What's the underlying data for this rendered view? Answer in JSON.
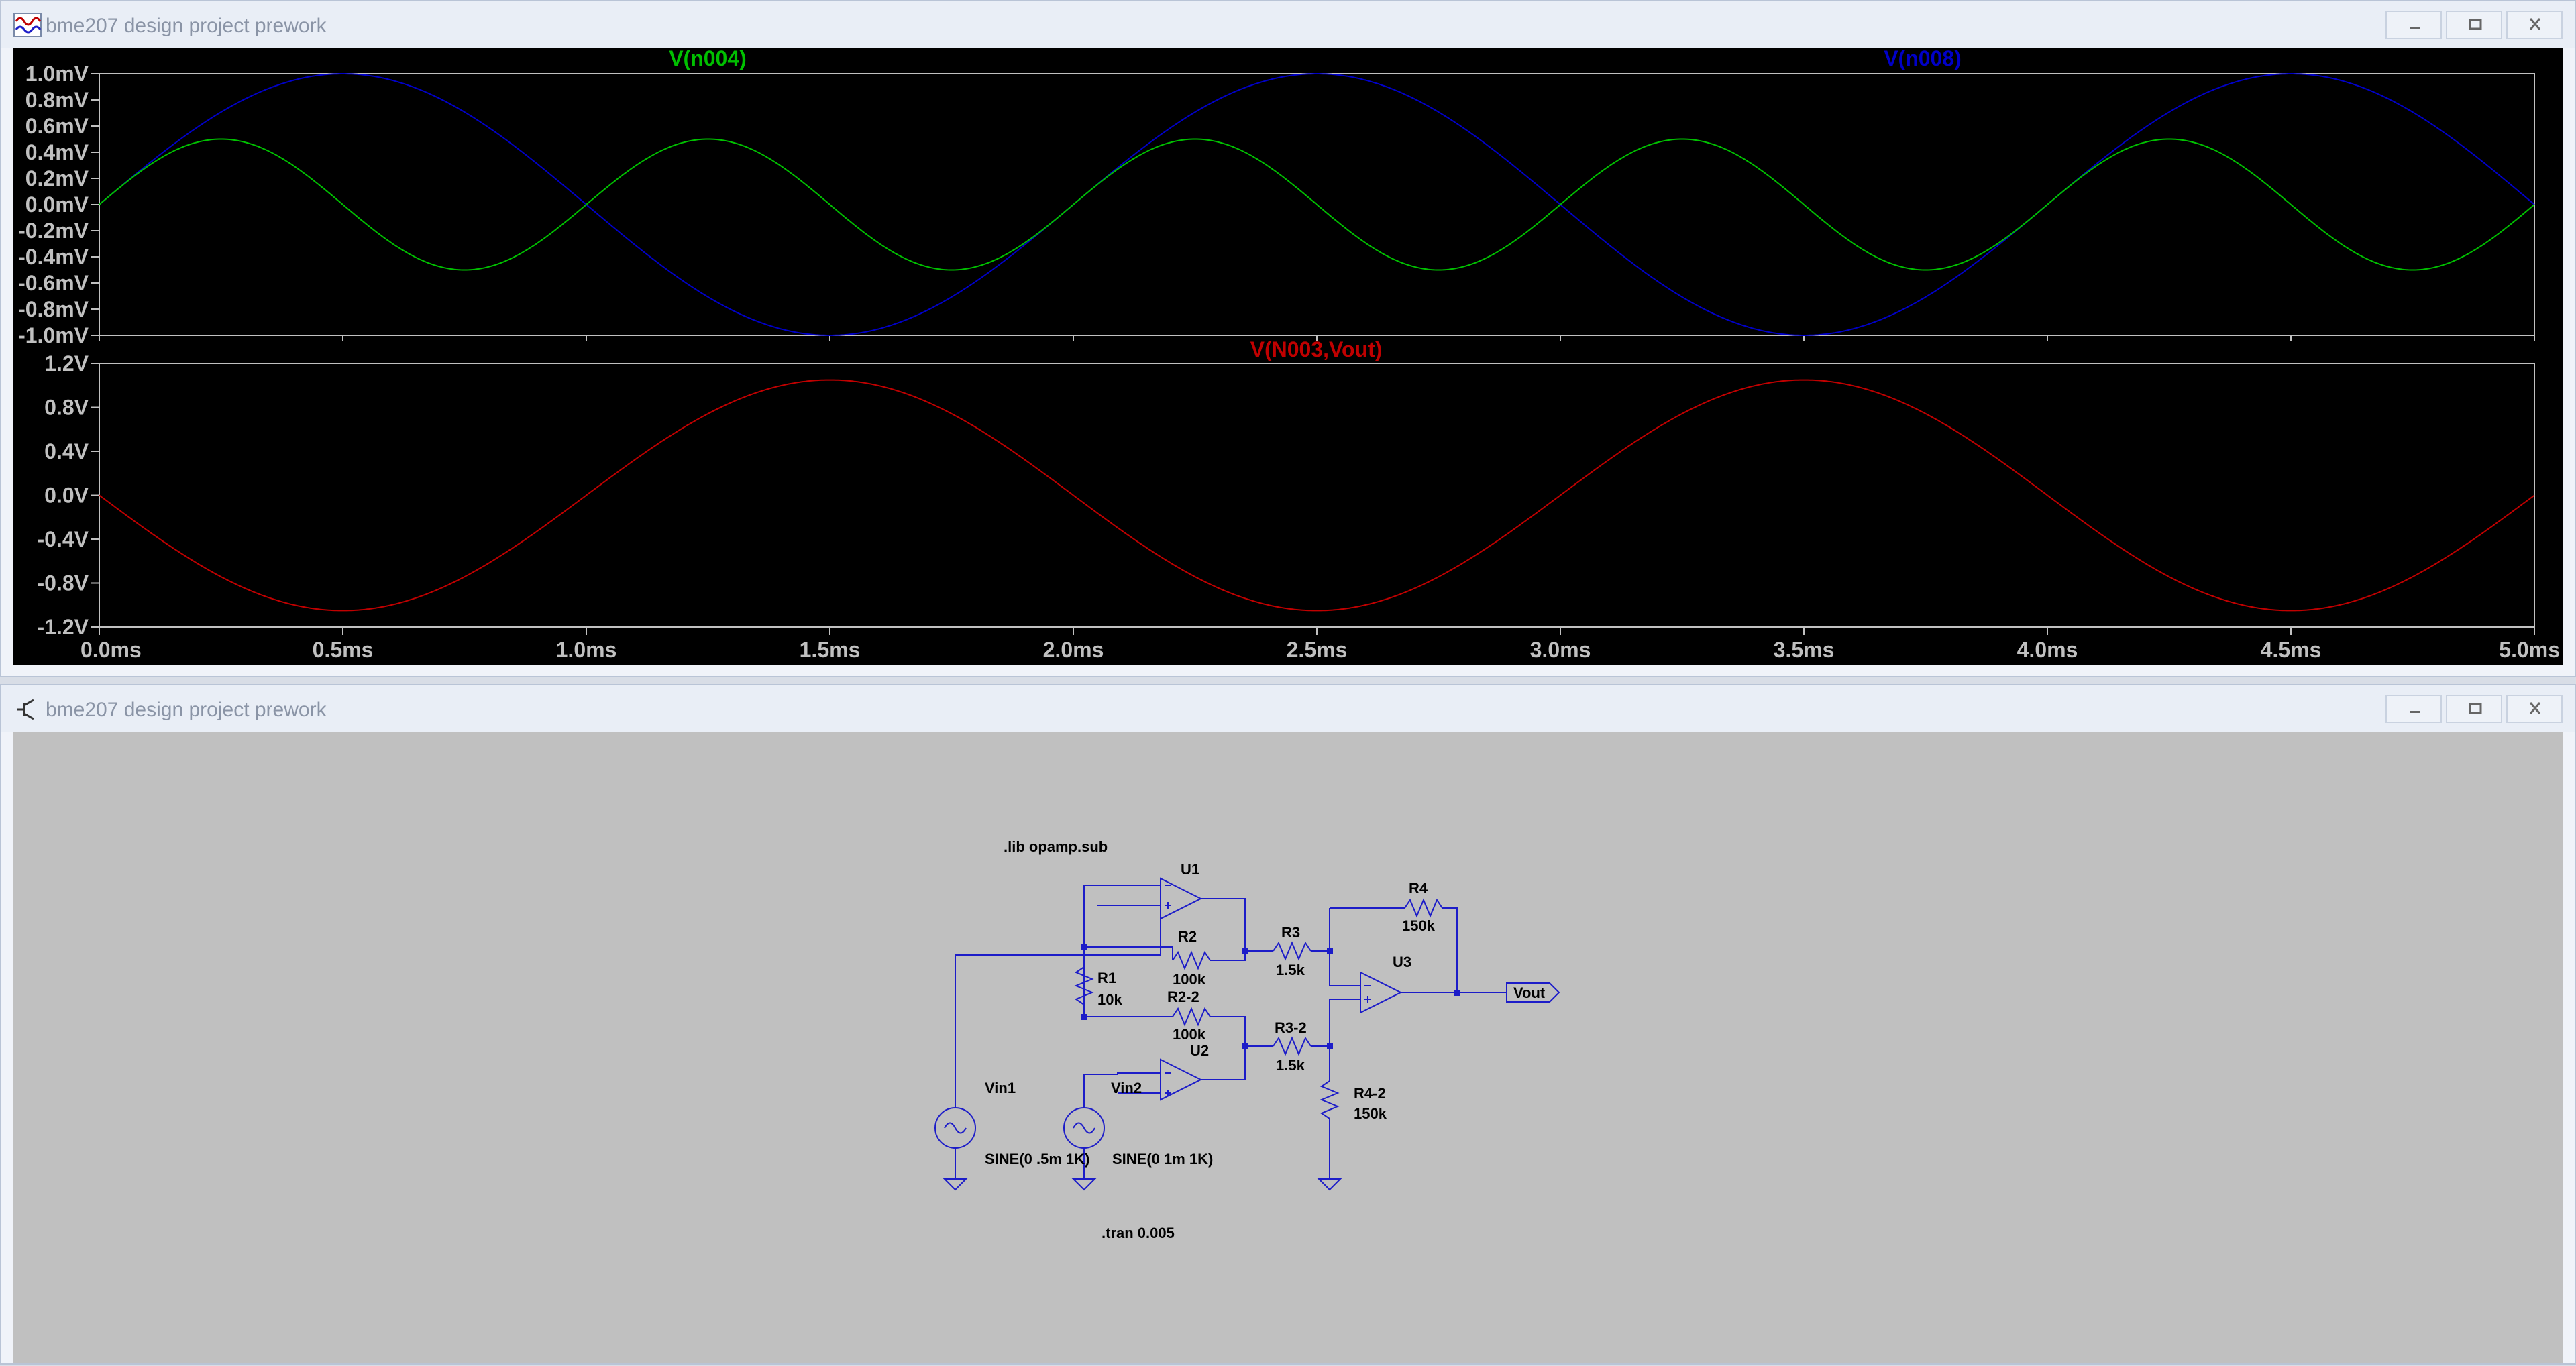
{
  "waveform_window": {
    "title": "bme207 design project prework",
    "icon": "waveform-viewer-icon"
  },
  "schematic_window": {
    "title": "bme207 design project prework",
    "icon": "schematic-editor-icon"
  },
  "window_buttons": {
    "minimize": "minimize-icon",
    "restore": "restore-icon",
    "close": "close-icon"
  },
  "colors": {
    "n004": "#00c000",
    "n008": "#0000c8",
    "diff": "#c00000",
    "wire": "#1c1cc8",
    "plot_bg": "#000000",
    "schematic_bg": "#c0c0c0"
  },
  "chart_data": [
    {
      "type": "line",
      "title": "",
      "xlabel": "",
      "ylabel": "",
      "series": [
        {
          "name": "V(n004)",
          "color": "#00c000",
          "function": "sine",
          "amplitude_mV": 0.5,
          "frequency_Hz": 1000
        },
        {
          "name": "V(n008)",
          "color": "#0000c8",
          "function": "sine",
          "amplitude_mV": 1.0,
          "frequency_Hz": 500
        }
      ],
      "xlim": [
        0,
        5
      ],
      "ylim": [
        -1.0,
        1.0
      ],
      "yticks": [
        "1.0mV",
        "0.8mV",
        "0.6mV",
        "0.4mV",
        "0.2mV",
        "0.0mV",
        "-0.2mV",
        "-0.4mV",
        "-0.6mV",
        "-0.8mV",
        "-1.0mV"
      ],
      "ytick_values": [
        1.0,
        0.8,
        0.6,
        0.4,
        0.2,
        0.0,
        -0.2,
        -0.4,
        -0.6,
        -0.8,
        -1.0
      ]
    },
    {
      "type": "line",
      "title": "",
      "xlabel": "",
      "ylabel": "",
      "series": [
        {
          "name": "V(N003,Vout)",
          "color": "#c00000",
          "function": "neg_sine",
          "amplitude_V": 1.05,
          "frequency_Hz": 500
        }
      ],
      "xlim": [
        0,
        5
      ],
      "ylim": [
        -1.2,
        1.2
      ],
      "yticks": [
        "1.2V",
        "0.8V",
        "0.4V",
        "0.0V",
        "-0.4V",
        "-0.8V",
        "-1.2V"
      ],
      "ytick_values": [
        1.2,
        0.8,
        0.4,
        0.0,
        -0.4,
        -0.8,
        -1.2
      ],
      "xticks": [
        "0.0ms",
        "0.5ms",
        "1.0ms",
        "1.5ms",
        "2.0ms",
        "2.5ms",
        "3.0ms",
        "3.5ms",
        "4.0ms",
        "4.5ms",
        "5.0ms"
      ],
      "xtick_values": [
        0,
        0.5,
        1.0,
        1.5,
        2.0,
        2.5,
        3.0,
        3.5,
        4.0,
        4.5,
        5.0
      ]
    }
  ],
  "schematic": {
    "directive_lib": ".lib opamp.sub",
    "directive_tran": ".tran 0.005",
    "u1": "U1",
    "u2": "U2",
    "u3": "U3",
    "r1": "R1",
    "r1_value": "10k",
    "r2": "R2",
    "r2_value": "100k",
    "r2_2": "R2-2",
    "r2_2_value": "100k",
    "r3": "R3",
    "r3_value": "1.5k",
    "r3_2": "R3-2",
    "r3_2_value": "1.5k",
    "r4": "R4",
    "r4_value": "150k",
    "r4_2": "R4-2",
    "r4_2_value": "150k",
    "vin1": "Vin1",
    "vin1_value": "SINE(0 .5m 1K)",
    "vin2": "Vin2",
    "vin2_value": "SINE(0 1m 1K)",
    "vout": "Vout"
  }
}
